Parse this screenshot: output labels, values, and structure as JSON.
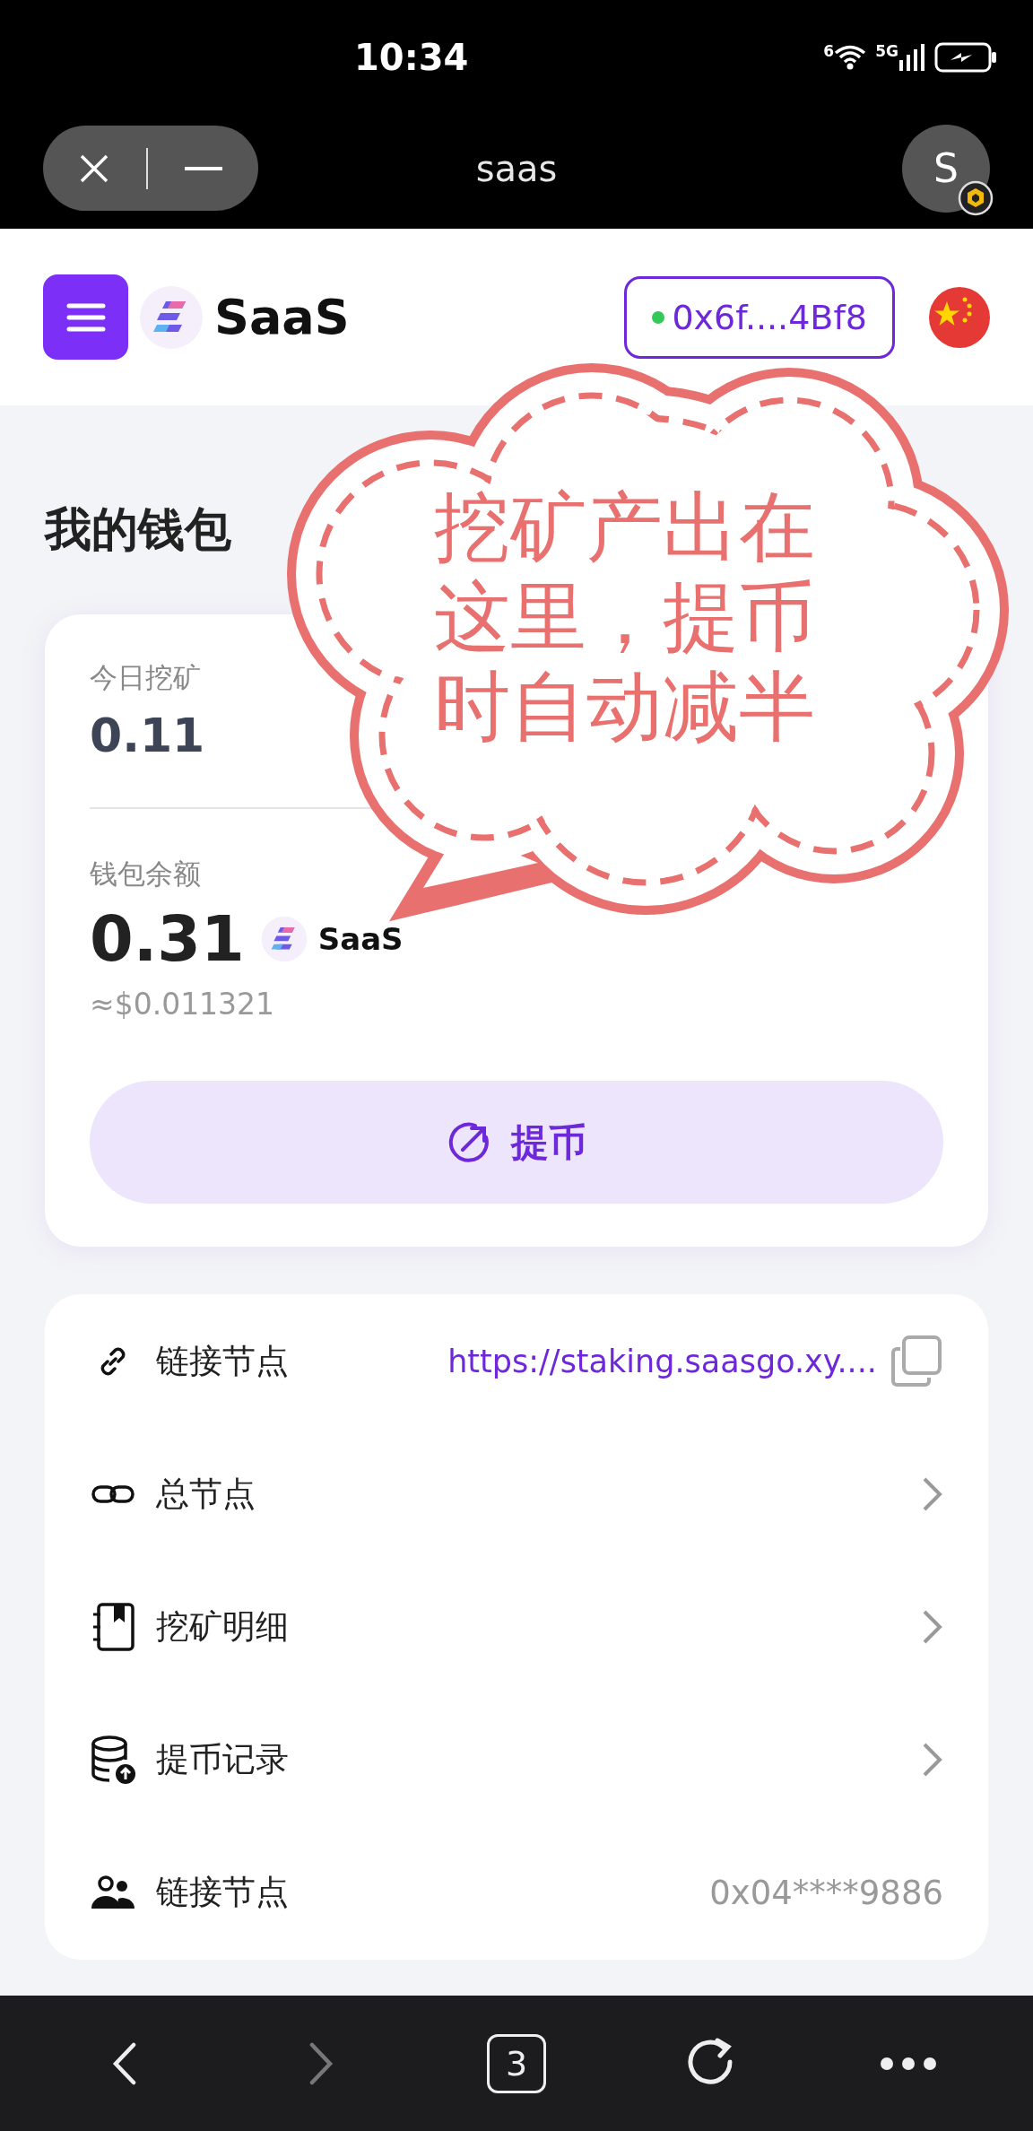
{
  "status_bar": {
    "time": "10:34",
    "wifi_label": "6",
    "network": "5G"
  },
  "browser_bar": {
    "title": "saas",
    "avatar": "S"
  },
  "header": {
    "brand": "SaaS",
    "address": "0x6f....4Bf8",
    "connected": true
  },
  "wallet": {
    "title": "我的钱包",
    "stats": [
      {
        "label": "今日挖矿",
        "value": "0.11"
      }
    ],
    "balance_label": "钱包余额",
    "balance": "0.31",
    "token": "SaaS",
    "usd_value": "≈$0.011321",
    "withdraw_button": "提币"
  },
  "menu": [
    {
      "kind": "link",
      "label": "链接节点",
      "value": "https://staking.saasgo.xy...."
    },
    {
      "kind": "chevron",
      "label": "总节点"
    },
    {
      "kind": "chevron",
      "label": "挖矿明细"
    },
    {
      "kind": "chevron",
      "label": "提币记录"
    },
    {
      "kind": "text",
      "label": "链接节点",
      "value": "0x04****9886"
    }
  ],
  "nav": [
    {
      "kind": "back",
      "disabled": false
    },
    {
      "kind": "forward",
      "disabled": true
    },
    {
      "kind": "tabs",
      "count": "3"
    },
    {
      "kind": "reload"
    },
    {
      "kind": "more"
    }
  ],
  "callout": {
    "text": "挖矿产出在这里，提币时自动减半"
  }
}
